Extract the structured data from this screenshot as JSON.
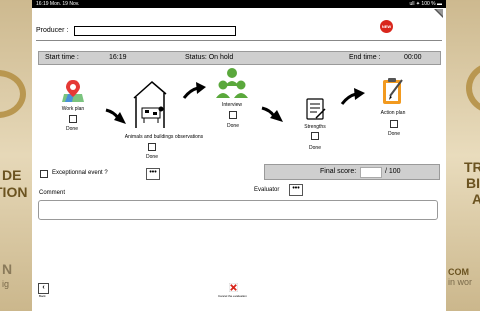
{
  "status_bar": {
    "time_date": "16:19  Mon. 19 Nov.",
    "right": "ull ✦ 100 % ▬"
  },
  "badge": "NEW",
  "producer": {
    "label": "Producer :",
    "value": ""
  },
  "time_bar": {
    "start_label": "Start time :",
    "start_value": "16:19",
    "status": "Status: On hold",
    "end_label": "End time :",
    "end_value": "00:00"
  },
  "steps": [
    {
      "label": "Work plan",
      "done": "Done",
      "icon": "map-pin-icon"
    },
    {
      "label": "Animals and buildings observations",
      "done": "Done",
      "icon": "barn-cow-icon"
    },
    {
      "label": "Interview",
      "done": "Done",
      "icon": "people-icon"
    },
    {
      "label": "Strengths",
      "done": "Done",
      "icon": "document-icon"
    },
    {
      "label": "Action plan",
      "done": "Done",
      "icon": "clipboard-icon"
    }
  ],
  "exceptional": {
    "label": "Exceptionnal event ?",
    "button": "•••"
  },
  "score": {
    "label": "Final score:",
    "max": "/ 100"
  },
  "comment": {
    "label": "Comment"
  },
  "evaluator": {
    "label": "Evaluator",
    "button": "•••"
  },
  "footer": {
    "back_label": "Back",
    "cancel_label": "Cancel the evaluation"
  },
  "background": {
    "left_lines": [
      "DE",
      "TION"
    ],
    "right_lines": [
      "TR",
      "BI",
      "A"
    ],
    "bottom_left": [
      "N",
      "ig"
    ],
    "bottom_right": [
      "COM",
      "in wor"
    ]
  },
  "colors": {
    "accent_red": "#d9261c",
    "green": "#5aa83c",
    "orange": "#f29a1f"
  }
}
